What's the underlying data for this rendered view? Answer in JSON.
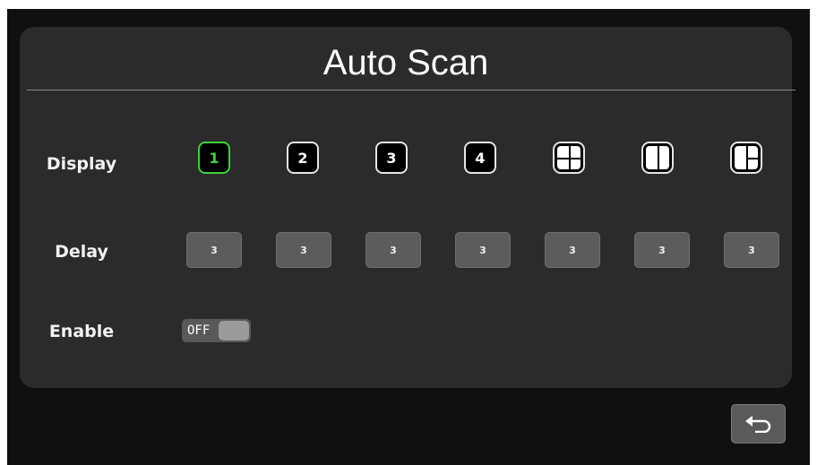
{
  "title": "Auto Scan",
  "rows": {
    "display_label": "Display",
    "delay_label": "Delay",
    "enable_label": "Enable"
  },
  "display_buttons": [
    {
      "label": "1",
      "active": true
    },
    {
      "label": "2",
      "active": false
    },
    {
      "label": "3",
      "active": false
    },
    {
      "label": "4",
      "active": false
    }
  ],
  "layout_buttons": [
    {
      "icon": "quad-split-icon"
    },
    {
      "icon": "dual-split-icon"
    },
    {
      "icon": "triple-split-icon"
    }
  ],
  "delay_values": [
    "3",
    "3",
    "3",
    "3",
    "3",
    "3",
    "3"
  ],
  "enable_toggle": {
    "state_label": "OFF"
  },
  "back_button": {
    "icon": "return-arrow-icon"
  },
  "colors": {
    "active_accent": "#3ad43a",
    "panel": "#2b2b2b",
    "background": "#101010"
  }
}
